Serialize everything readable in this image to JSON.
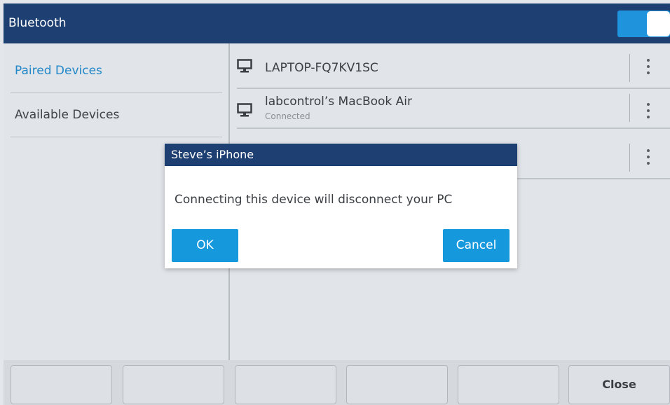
{
  "header": {
    "title": "Bluetooth",
    "toggle_on": true
  },
  "left_nav": {
    "items": [
      {
        "label": "Paired Devices",
        "active": true
      },
      {
        "label": "Available Devices",
        "active": false
      }
    ]
  },
  "devices": [
    {
      "name": "LAPTOP-FQ7KV1SC",
      "status": "",
      "icon": "monitor-icon"
    },
    {
      "name": "labcontrol’s MacBook Air",
      "status": "Connected",
      "icon": "monitor-icon"
    },
    {
      "name": "",
      "status": "",
      "icon": ""
    }
  ],
  "dialog": {
    "title": "Steve’s iPhone",
    "message": "Connecting this device will disconnect your PC",
    "ok_label": "OK",
    "cancel_label": "Cancel"
  },
  "softkeys": [
    "",
    "",
    "",
    "",
    "",
    "Close"
  ],
  "colors": {
    "header_bg": "#1e3f72",
    "accent": "#1698dc",
    "active_text": "#2388c9"
  }
}
